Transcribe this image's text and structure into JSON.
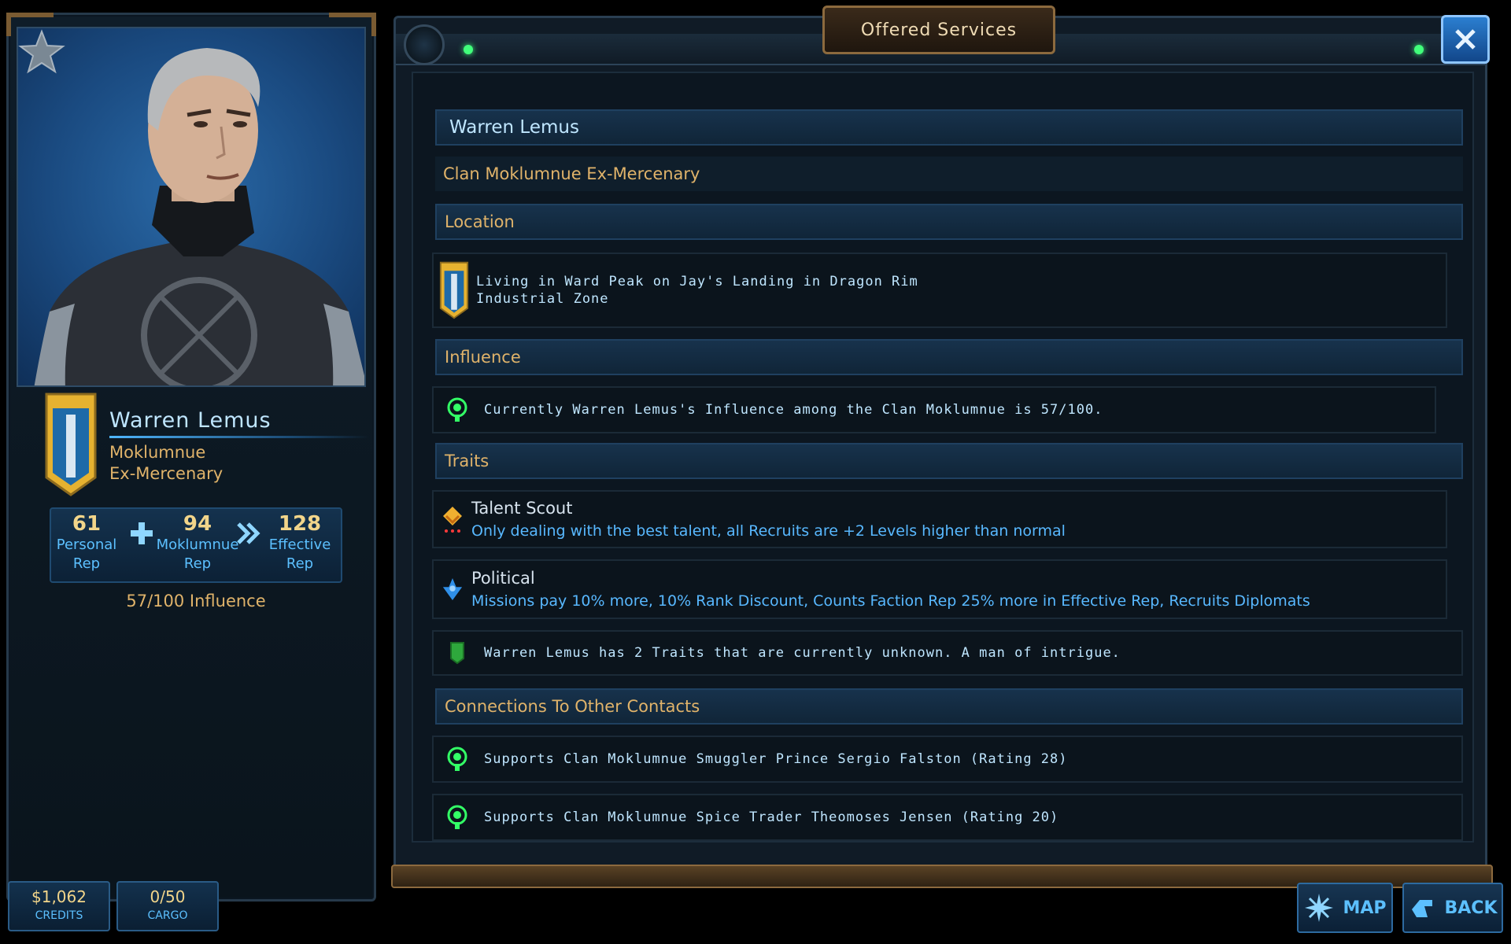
{
  "window": {
    "title": "Offered Services"
  },
  "contact": {
    "name": "Warren Lemus",
    "faction": "Moklumnue",
    "role": "Ex-Mercenary",
    "rep": {
      "personal": {
        "value": "61",
        "label1": "Personal",
        "label2": "Rep"
      },
      "faction": {
        "value": "94",
        "label1": "Moklumnue",
        "label2": "Rep"
      },
      "effective": {
        "value": "128",
        "label1": "Effective",
        "label2": "Rep"
      }
    },
    "influence": "57/100 Influence"
  },
  "details": {
    "name": "Warren Lemus",
    "subtitle": "Clan Moklumnue Ex-Mercenary",
    "location_header": "Location",
    "location_line1": "Living in Ward Peak on Jay's Landing in Dragon Rim",
    "location_line2": "Industrial Zone",
    "influence_header": "Influence",
    "influence_text": "Currently Warren Lemus's Influence among the Clan Moklumnue is 57/100.",
    "traits_header": "Traits",
    "traits": [
      {
        "title": "Talent Scout",
        "desc": "Only dealing with the best talent, all Recruits are +2 Levels higher than normal"
      },
      {
        "title": "Political",
        "desc": "Missions pay 10% more, 10% Rank Discount, Counts Faction Rep 25% more in Effective Rep, Recruits Diplomats"
      }
    ],
    "unknown_traits": "Warren Lemus has 2 Traits that are currently unknown. A man of intrigue.",
    "connections_header": "Connections To Other Contacts",
    "connections": [
      "Supports Clan Moklumnue Smuggler Prince Sergio Falston (Rating 28)",
      "Supports Clan Moklumnue Spice Trader Theomoses Jensen (Rating 20)"
    ]
  },
  "status": {
    "credits": {
      "value": "$1,062",
      "label": "CREDITS"
    },
    "cargo": {
      "value": "0/50",
      "label": "CARGO"
    }
  },
  "nav": {
    "map": "MAP",
    "back": "BACK"
  },
  "colors": {
    "accent_blue": "#5cc0ff",
    "gold": "#e0b36a",
    "green": "#41ff7b"
  }
}
